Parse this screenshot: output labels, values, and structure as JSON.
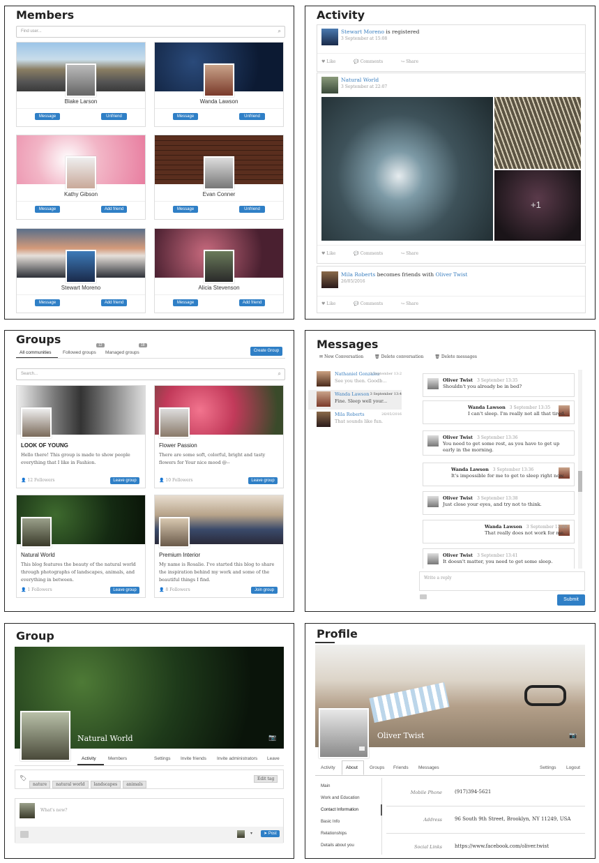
{
  "members": {
    "title": "Members",
    "search_placeholder": "Find user...",
    "cards": [
      {
        "name": "Blake Larson",
        "btn1": "Message",
        "btn2": "Unfriend"
      },
      {
        "name": "Wanda Lawson",
        "btn1": "Message",
        "btn2": "Unfriend"
      },
      {
        "name": "Kathy Gibson",
        "btn1": "Message",
        "btn2": "Add friend"
      },
      {
        "name": "Evan Conner",
        "btn1": "Message",
        "btn2": "Unfriend"
      },
      {
        "name": "Stewart Moreno",
        "btn1": "Message",
        "btn2": "Add friend"
      },
      {
        "name": "Alicia Stevenson",
        "btn1": "Message",
        "btn2": "Add friend"
      }
    ]
  },
  "activity": {
    "title": "Activity",
    "posts": [
      {
        "user": "Stewart Moreno",
        "text": "is registered",
        "date": "3 September at 15:08"
      },
      {
        "user": "Natural World",
        "text": "",
        "date": "3 September at 22:07",
        "more": "+1"
      },
      {
        "user": "Mila Roberts",
        "text": "becomes friends with",
        "target": "Oliver Twist",
        "date": "26/05/2016"
      }
    ],
    "actions": {
      "like": "Like",
      "comments": "Comments",
      "share": "Share"
    }
  },
  "groups": {
    "title": "Groups",
    "tabs": [
      "All communities",
      "Followed groups",
      "Managed groups"
    ],
    "badges": [
      "12",
      "18"
    ],
    "create": "Create Group",
    "search_placeholder": "Search...",
    "cards": [
      {
        "title": "LOOK OF YOUNG",
        "desc": "Hello there! This group is made to show people everything that I like in Fashion.",
        "followers": "12 Followers",
        "btn": "Leave group"
      },
      {
        "title": "Flower Passion",
        "desc": "There are some soft, colorful, bright and tasty flowers for Your nice mood @--",
        "followers": "10 Followers",
        "btn": "Leave group"
      },
      {
        "title": "Natural World",
        "desc": "This blog features the beauty of the natural world through photographs of landscapes, animals, and everything in between.",
        "followers": "1 Followers",
        "btn": "Leave group"
      },
      {
        "title": "Premium Interior",
        "desc": "My name is Rosalie. I've started this blog to share the inspiration behind my work and some of the beautiful things I find.",
        "followers": "8 Followers",
        "btn": "Join group"
      }
    ]
  },
  "messages": {
    "title": "Messages",
    "toolbar": [
      "New Conversation",
      "Delete conversation",
      "Delete messages"
    ],
    "list": [
      {
        "name": "Nathaniel Gonzalez",
        "time": "3 September 13:2",
        "preview": "See you then. Goodb..."
      },
      {
        "name": "Wanda Lawson",
        "time": "3 September 13:4",
        "preview": "Fine. Sleep well your..."
      },
      {
        "name": "Mila Roberts",
        "time": "26/05/2016",
        "preview": "That sounds like fun."
      }
    ],
    "thread": [
      {
        "name": "Oliver Twist",
        "date": "3 September 13:35",
        "text": "Shouldn't you already be in bed?",
        "side": "left"
      },
      {
        "name": "Wanda Lawson",
        "date": "3 September 13:35",
        "text": "I can't sleep. I'm really not all that tired.",
        "side": "right"
      },
      {
        "name": "Oliver Twist",
        "date": "3 September 13:36",
        "text": "You need to get some rest, as you have to get up early in the morning.",
        "side": "left"
      },
      {
        "name": "Wanda Lawson",
        "date": "3 September 13:36",
        "text": "It's impossible for me to get to sleep right now.",
        "side": "right"
      },
      {
        "name": "Oliver Twist",
        "date": "3 September 13:38",
        "text": "Just close your eyes, and try not to think.",
        "side": "left"
      },
      {
        "name": "Wanda Lawson",
        "date": "3 September 13:40",
        "text": "That really does not work for me.",
        "side": "right"
      },
      {
        "name": "Oliver Twist",
        "date": "3 September 13:41",
        "text": "It doesn't matter, you need to get some sleep.",
        "side": "left"
      }
    ],
    "reply_placeholder": "Write a reply",
    "submit": "Submit"
  },
  "group": {
    "title": "Group",
    "name": "Natural World",
    "tabs": [
      "Activity",
      "Members",
      "Settings",
      "Invite friends",
      "Invite administrators",
      "Leave"
    ],
    "tags": [
      "nature",
      "natural world",
      "landscapes",
      "animals"
    ],
    "edit_tag": "Edit tag",
    "whats_new": "What's new?",
    "post": "Post"
  },
  "profile": {
    "title": "Profile",
    "name": "Oliver Twist",
    "tabs": [
      "Activity",
      "About",
      "Groups",
      "Friends",
      "Messages"
    ],
    "right_tabs": [
      "Settings",
      "Logout"
    ],
    "side": [
      "Main",
      "Work and Education",
      "Contact Information",
      "Basic Info",
      "Relationships",
      "Details about you"
    ],
    "rows": [
      {
        "k": "Mobile Phone",
        "v": "(917)394-5621"
      },
      {
        "k": "Address",
        "v": "96 South 9th Street, Brooklyn, NY 11249, USA"
      },
      {
        "k": "Social Links",
        "v": "https://www.facebook.com/oliver.twist"
      }
    ]
  }
}
